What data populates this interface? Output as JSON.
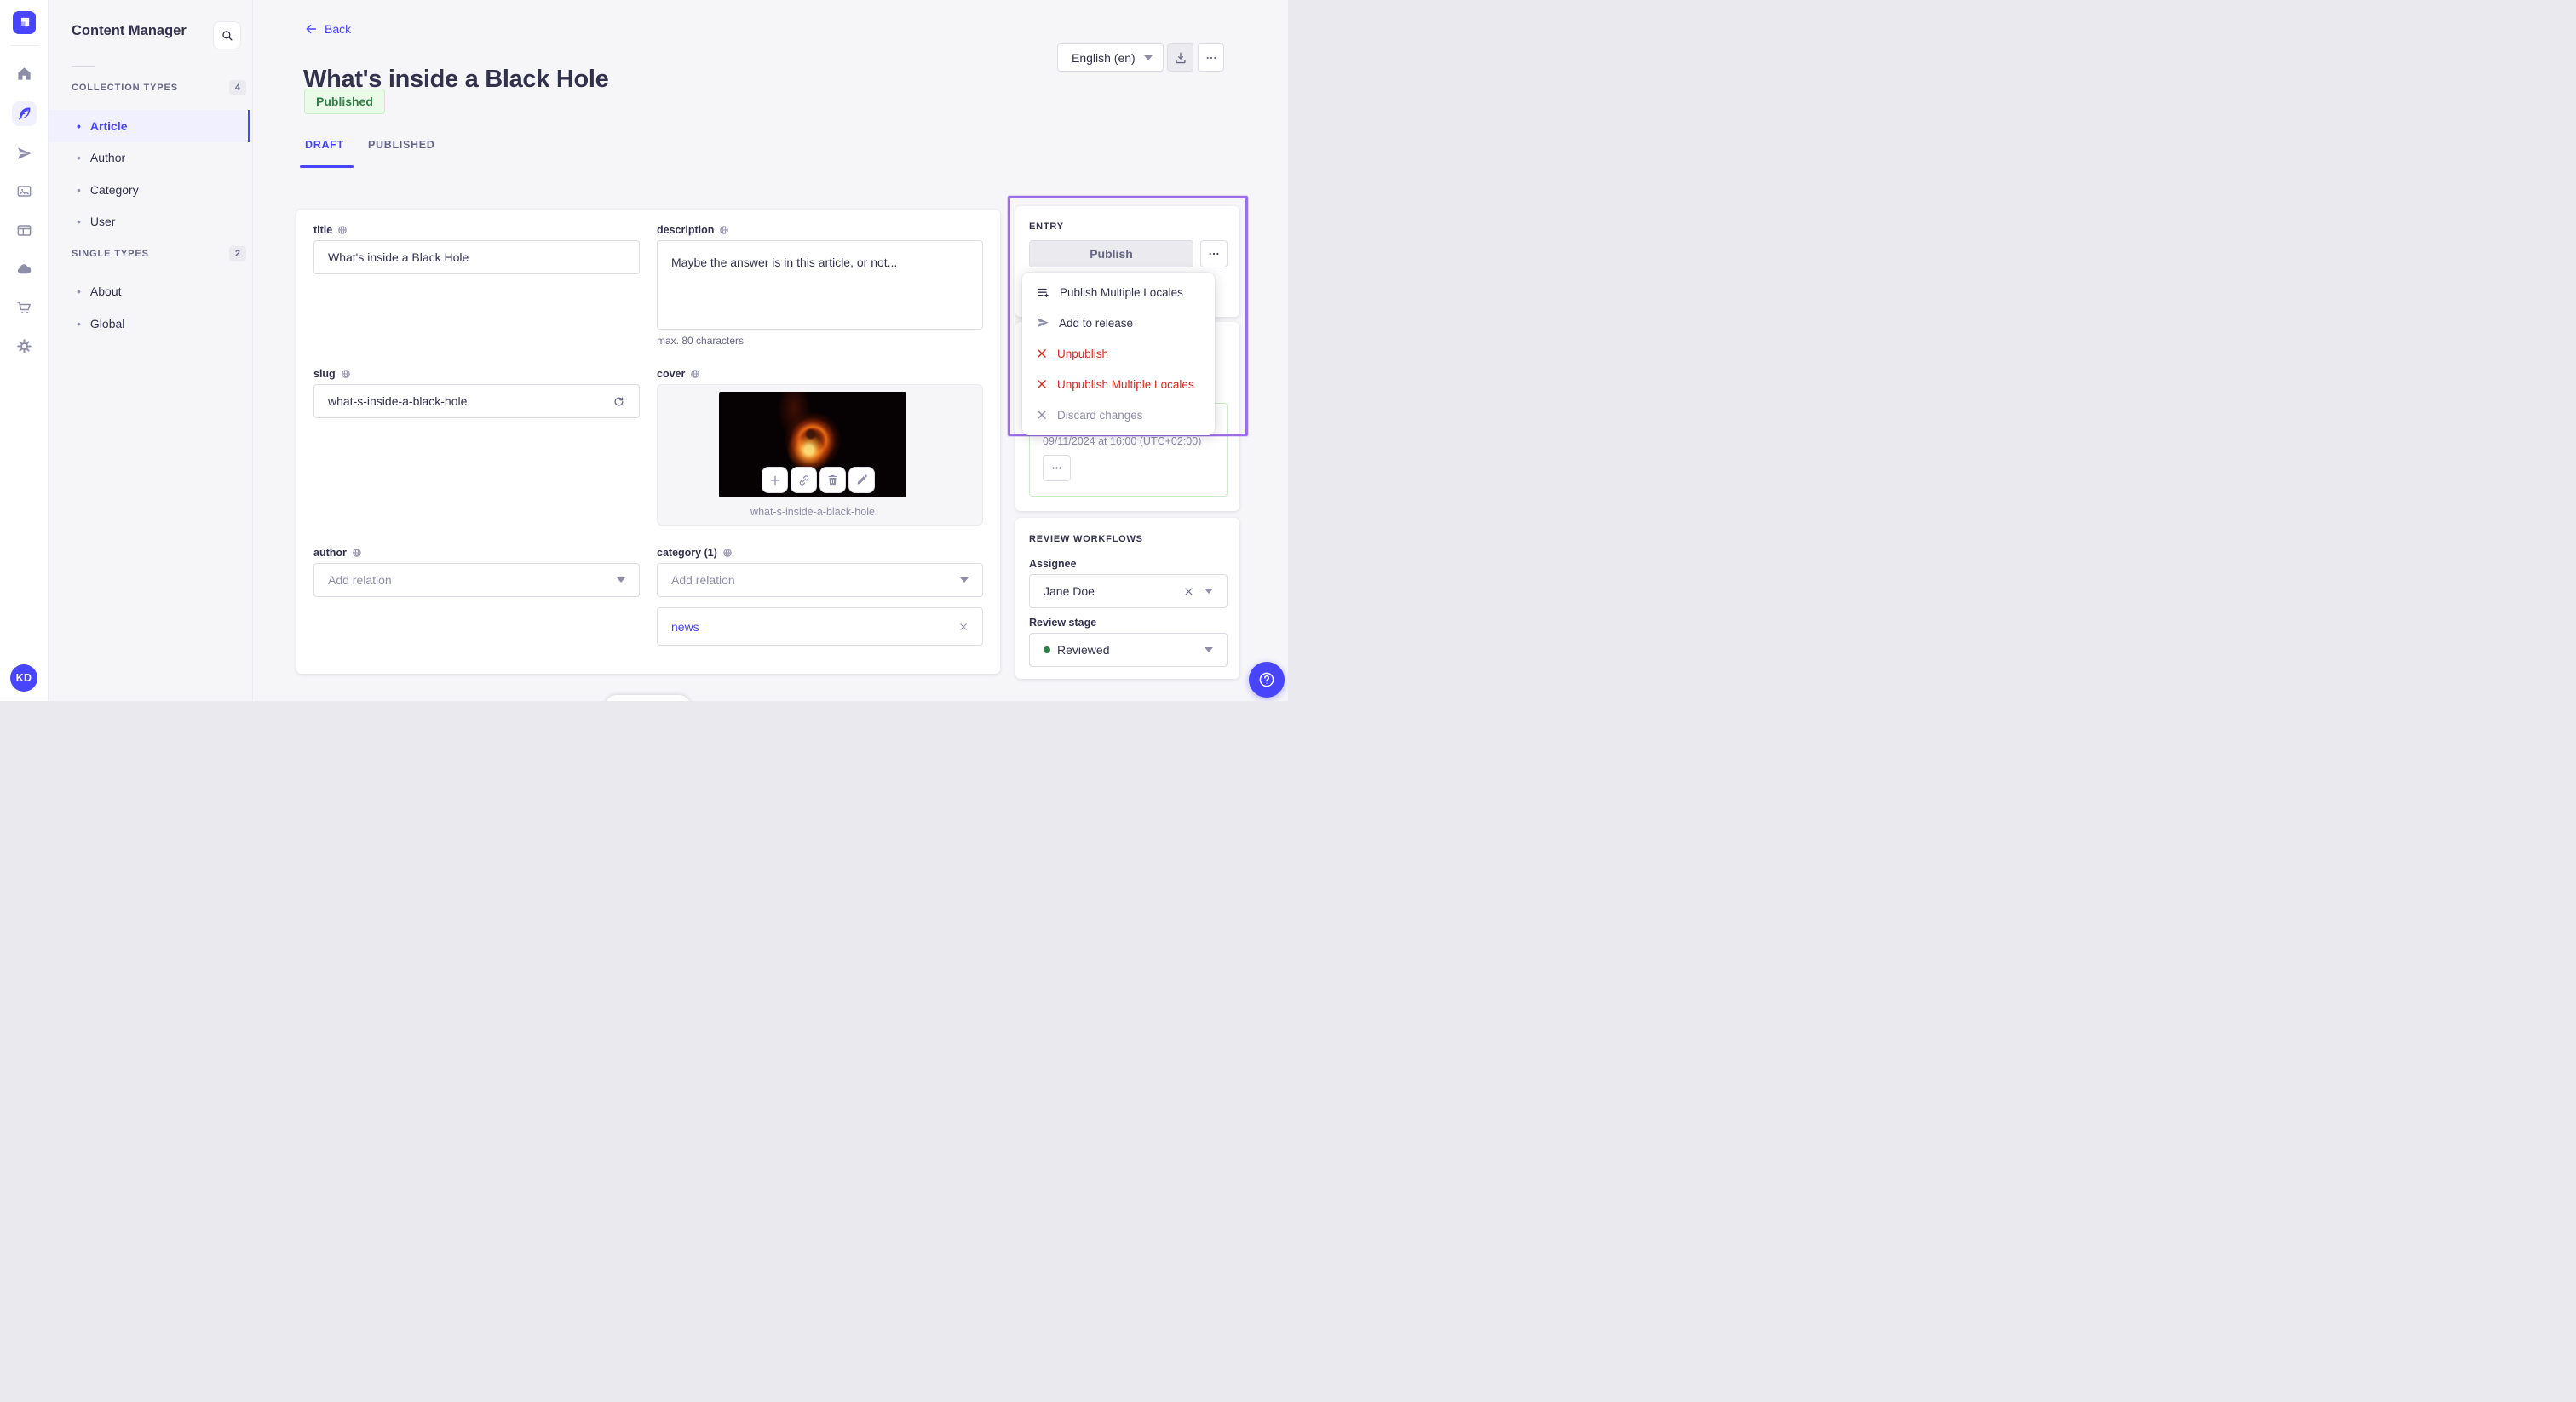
{
  "colors": {
    "accent": "#4945ff",
    "highlight_purple": "#9a6fe9",
    "success_text": "#328048",
    "success_bg": "#eafbe7",
    "success_border": "#c6f0c2",
    "danger": "#d02b20",
    "text_dark": "#32324d",
    "text_mid": "#666687",
    "text_soft": "#8e8ea9",
    "border": "#dcdce4",
    "background": "#f6f6f9"
  },
  "sidebar": {
    "logo_icon": "strapi-logo",
    "icons": [
      "home-icon",
      "content-manager-icon",
      "releases-icon",
      "media-library-icon",
      "content-type-builder-icon",
      "cloud-icon",
      "marketplace-icon",
      "settings-icon"
    ],
    "avatar_initials": "KD"
  },
  "subnav": {
    "title": "Content Manager",
    "search_icon": "search-icon",
    "sections": [
      {
        "label": "COLLECTION TYPES",
        "count": "4",
        "items": [
          {
            "label": "Article"
          },
          {
            "label": "Author"
          },
          {
            "label": "Category"
          },
          {
            "label": "User"
          }
        ]
      },
      {
        "label": "SINGLE TYPES",
        "count": "2",
        "items": [
          {
            "label": "About"
          },
          {
            "label": "Global"
          }
        ]
      }
    ]
  },
  "header": {
    "back_label": "Back",
    "title": "What's inside a Black Hole",
    "status_badge": "Published",
    "tabs": [
      {
        "label": "DRAFT"
      },
      {
        "label": "PUBLISHED"
      }
    ],
    "locale_value": "English (en)"
  },
  "form": {
    "title": {
      "label": "title",
      "value": "What's inside a Black Hole"
    },
    "description": {
      "label": "description",
      "value": "Maybe the answer is in this article, or not...",
      "helper": "max. 80 characters"
    },
    "slug": {
      "label": "slug",
      "value": "what-s-inside-a-black-hole"
    },
    "cover": {
      "label": "cover",
      "caption": "what-s-inside-a-black-hole"
    },
    "author": {
      "label": "author",
      "placeholder": "Add relation"
    },
    "category": {
      "label": "category (1)",
      "placeholder": "Add relation",
      "relation_value": "news"
    }
  },
  "entry": {
    "heading": "ENTRY",
    "publish_label": "Publish",
    "more_label": "more-options",
    "menu": [
      {
        "label": "Publish Multiple Locales"
      },
      {
        "label": "Add to release"
      },
      {
        "label": "Unpublish"
      },
      {
        "label": "Unpublish Multiple Locales"
      },
      {
        "label": "Discard changes"
      }
    ],
    "scheduled_date": "09/11/2024 at 16:00 (UTC+02:00)"
  },
  "review": {
    "heading": "REVIEW WORKFLOWS",
    "assignee_label": "Assignee",
    "assignee_value": "Jane Doe",
    "stage_label": "Review stage",
    "stage_value": "Reviewed"
  }
}
